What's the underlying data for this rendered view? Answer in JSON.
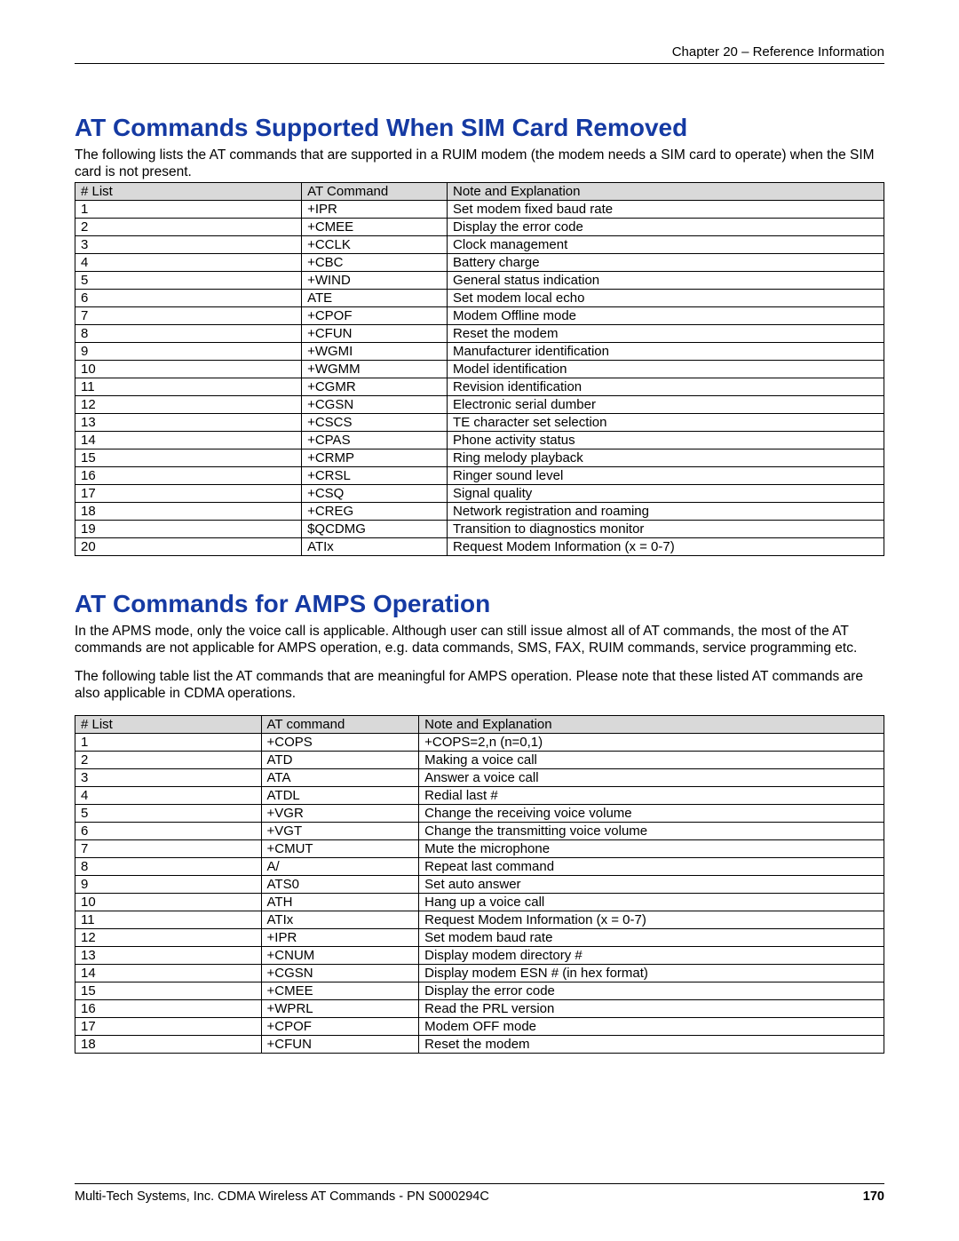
{
  "header": {
    "chapter": "Chapter 20 – Reference Information"
  },
  "section1": {
    "heading": "AT Commands Supported When SIM Card Removed",
    "paragraph": "The following lists the AT commands that are supported in a RUIM modem (the modem needs a SIM card to operate) when the SIM card is not present.",
    "table": {
      "headers": [
        "# List",
        "AT Command",
        "Note and Explanation"
      ],
      "rows": [
        [
          "1",
          "+IPR",
          "Set modem fixed baud rate"
        ],
        [
          "2",
          "+CMEE",
          "Display the error code"
        ],
        [
          "3",
          "+CCLK",
          "Clock management"
        ],
        [
          "4",
          "+CBC",
          "Battery charge"
        ],
        [
          "5",
          "+WIND",
          "General status indication"
        ],
        [
          "6",
          "ATE",
          "Set modem local echo"
        ],
        [
          "7",
          "+CPOF",
          "Modem Offline mode"
        ],
        [
          "8",
          "+CFUN",
          "Reset the modem"
        ],
        [
          "9",
          "+WGMI",
          "Manufacturer identification"
        ],
        [
          "10",
          "+WGMM",
          "Model identification"
        ],
        [
          "11",
          "+CGMR",
          "Revision identification"
        ],
        [
          "12",
          "+CGSN",
          "Electronic serial dumber"
        ],
        [
          "13",
          "+CSCS",
          "TE character set selection"
        ],
        [
          "14",
          "+CPAS",
          "Phone activity status"
        ],
        [
          "15",
          "+CRMP",
          "Ring melody playback"
        ],
        [
          "16",
          "+CRSL",
          "Ringer sound level"
        ],
        [
          "17",
          "+CSQ",
          "Signal quality"
        ],
        [
          "18",
          "+CREG",
          "Network registration and roaming"
        ],
        [
          "19",
          "$QCDMG",
          "Transition to diagnostics monitor"
        ],
        [
          "20",
          "ATIx",
          "Request Modem Information (x = 0-7)"
        ]
      ]
    }
  },
  "section2": {
    "heading": "AT Commands for AMPS Operation",
    "paragraph1": "In the APMS mode, only the voice call is applicable. Although user can still issue almost all of AT commands, the most of the AT commands are not applicable for AMPS operation, e.g. data commands, SMS, FAX, RUIM commands, service programming etc.",
    "paragraph2": "The following table list the AT commands that are meaningful for AMPS operation. Please note that these listed AT commands are also applicable in CDMA operations.",
    "table": {
      "headers": [
        "# List",
        "AT command",
        "Note and Explanation"
      ],
      "rows": [
        [
          "1",
          "+COPS",
          "+COPS=2,n (n=0,1)"
        ],
        [
          "2",
          "ATD",
          "Making a voice call"
        ],
        [
          "3",
          "ATA",
          "Answer a voice call"
        ],
        [
          "4",
          "ATDL",
          "Redial last #"
        ],
        [
          "5",
          "+VGR",
          "Change the receiving voice volume"
        ],
        [
          "6",
          "+VGT",
          "Change the transmitting voice volume"
        ],
        [
          "7",
          "+CMUT",
          "Mute the microphone"
        ],
        [
          "8",
          "A/",
          "Repeat last command"
        ],
        [
          "9",
          "ATS0",
          "Set auto answer"
        ],
        [
          "10",
          "ATH",
          "Hang up a voice call"
        ],
        [
          "11",
          "ATIx",
          "Request Modem Information (x = 0-7)"
        ],
        [
          "12",
          "+IPR",
          "Set modem baud rate"
        ],
        [
          "13",
          "+CNUM",
          "Display modem directory #"
        ],
        [
          "14",
          "+CGSN",
          "Display modem ESN # (in hex format)"
        ],
        [
          "15",
          "+CMEE",
          "Display the error code"
        ],
        [
          "16",
          "+WPRL",
          "Read the PRL version"
        ],
        [
          "17",
          "+CPOF",
          "Modem OFF mode"
        ],
        [
          "18",
          "+CFUN",
          "Reset the modem"
        ]
      ]
    }
  },
  "footer": {
    "text": "Multi-Tech Systems, Inc. CDMA Wireless AT Commands - PN S000294C",
    "page": "170"
  }
}
